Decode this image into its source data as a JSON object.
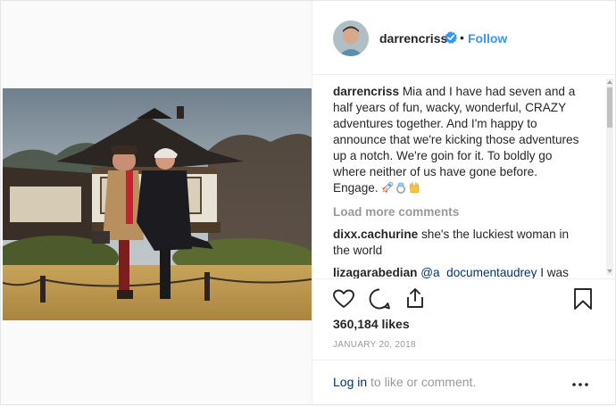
{
  "post": {
    "username": "darrencriss",
    "separator": "•",
    "follow_label": "Follow",
    "caption_user": "darrencriss",
    "caption_text": "Mia and I have had seven and a half years of fun, wacky, wonderful, CRAZY adventures together. And I'm happy to announce that we're kicking those adventures up a notch. We're goin for it. To boldly go where neither of us have gone before. Engage.",
    "caption_emojis": [
      "rocket-emoji",
      "ring-emoji",
      "vulcan-salute-emoji"
    ],
    "load_more_label": "Load more comments",
    "comments": [
      {
        "user": "dixx.cachurine",
        "text": "she's the luckiest woman in the world"
      },
      {
        "user": "lizagarabedian",
        "mention": "@a_documentaudrey",
        "text": "I was"
      }
    ],
    "likes": "360,184 likes",
    "date": "JANUARY 20, 2018",
    "login_link": "Log in",
    "login_rest": "to like or comment."
  },
  "colors": {
    "accent": "#3897f0",
    "text": "#262626",
    "muted": "#999999",
    "link": "#003569",
    "border": "#efefef"
  },
  "icons": [
    "heart-icon",
    "comment-icon",
    "share-icon",
    "bookmark-icon",
    "more-options-icon",
    "verified-badge-icon"
  ]
}
